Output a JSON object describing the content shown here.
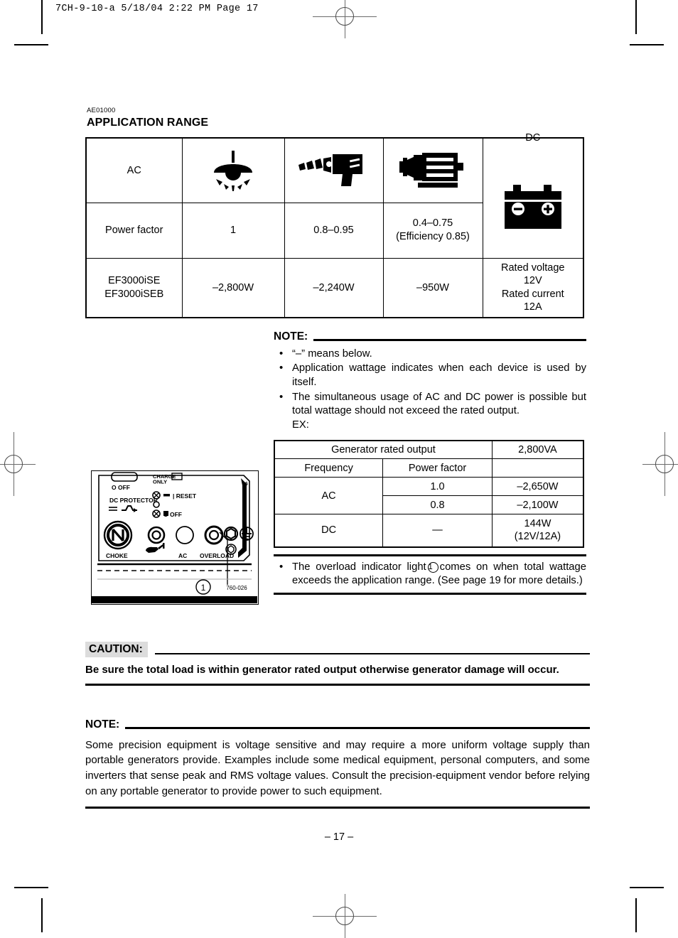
{
  "print_header": "7CH-9-10-a  5/18/04 2:22 PM  Page 17",
  "ref_code": "AE01000",
  "section_title": "APPLICATION RANGE",
  "application_range_table": {
    "rows": [
      {
        "label": "AC",
        "icons": [
          "light-bulb-icon",
          "drill-icon",
          "motor-icon"
        ],
        "dc_label": "DC"
      },
      {
        "label": "Power factor",
        "values": [
          "1",
          "0.8–0.95",
          "0.4–0.75\n(Efficiency 0.85)"
        ]
      },
      {
        "label": "EF3000iSE\nEF3000iSEB",
        "values": [
          "–2,800W",
          "–2,240W",
          "–950W"
        ],
        "dc_spec": "Rated voltage\n12V\nRated current\n12A"
      }
    ],
    "cells": {
      "ac_label": "AC",
      "dc_label": "DC",
      "power_factor_label": "Power factor",
      "pf_light": "1",
      "pf_drill": "0.8–0.95",
      "pf_motor_line1": "0.4–0.75",
      "pf_motor_line2": "(Efficiency 0.85)",
      "model_line1": "EF3000iSE",
      "model_line2": "EF3000iSEB",
      "w_light": "–2,800W",
      "w_drill": "–2,240W",
      "w_motor": "–950W",
      "dc_spec_line1": "Rated voltage",
      "dc_spec_line2": "12V",
      "dc_spec_line3": "Rated current",
      "dc_spec_line4": "12A"
    }
  },
  "note_top": {
    "label": "NOTE:",
    "bullets": [
      "“–” means below.",
      "Application wattage indicates when each device is used by itself.",
      "The simultaneous usage of AC and DC power is possible but total wattage should not exceed the rated output.",
      "EX:"
    ],
    "bullet1": "“–” means below.",
    "bullet2": "Application wattage indicates when each device is used by itself.",
    "bullet3": "The simultaneous usage of AC and DC power is possible but total wattage should not exceed the rated output.",
    "ex_label": "EX:"
  },
  "example_table": {
    "generator_rated_output_label": "Generator rated output",
    "generator_rated_output_value": "2,800VA",
    "frequency_label": "Frequency",
    "power_factor_label": "Power factor",
    "blank": "",
    "ac_label": "AC",
    "ac_pf_1": "1.0",
    "ac_w_1": "–2,650W",
    "ac_pf_2": "0.8",
    "ac_w_2": "–2,100W",
    "dc_label": "DC",
    "dc_pf": "—",
    "dc_w_line1": "144W",
    "dc_w_line2": "(12V/12A)"
  },
  "overload_note": {
    "text_before": "The overload indicator light",
    "callout": "1",
    "text_after": "comes on when total wattage exceeds the application range. (See page 19 for more details.)"
  },
  "control_panel": {
    "labels": {
      "off": "O OFF",
      "charge_only_line1": "CHARGE",
      "charge_only_line2": "ONLY",
      "dc_protector": "DC PROTECTOR",
      "reset": "RESET",
      "reset_prefix": "|",
      "off_lower": "O OFF",
      "choke": "CHOKE",
      "ac": "AC",
      "overload": "OVERLOAD"
    },
    "callout": "1",
    "figure_number": "760-026",
    "panel_code": "26"
  },
  "caution": {
    "label": "CAUTION:",
    "body": "Be sure the total load is within generator rated output otherwise generator damage will occur."
  },
  "note_bottom": {
    "label": "NOTE:",
    "body": "Some precision equipment is voltage sensitive and may require a more uniform voltage supply than portable generators provide. Examples include some medical equipment, personal computers, and some inverters that sense peak and RMS voltage values. Consult the precision-equipment vendor before relying on any portable generator to provide power to such equipment."
  },
  "page_number": "– 17 –",
  "colors": {
    "ink": "#000000",
    "caution_highlight": "#dcdcdc",
    "registration": "#6b6b6b"
  }
}
